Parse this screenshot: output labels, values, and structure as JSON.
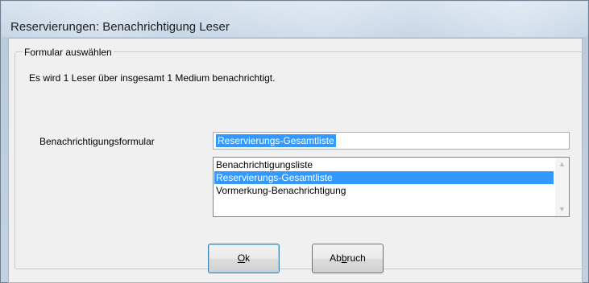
{
  "window": {
    "title": "Reservierungen: Benachrichtigung Leser"
  },
  "group": {
    "legend": "Formular auswählen",
    "info": "Es wird 1 Leser über  insgesamt 1 Medium benachrichtigt."
  },
  "form": {
    "label": "Benachrichtigungsformular",
    "combo_value": "Reservierungs-Gesamtliste",
    "list_items": [
      "Benachrichtigungsliste",
      "Reservierungs-Gesamtliste",
      "Vormerkung-Benachrichtigung"
    ],
    "selected_index": 1
  },
  "buttons": {
    "ok_mnemonic": "O",
    "ok_rest": "k",
    "cancel_pre": "Ab",
    "cancel_mnemonic": "b",
    "cancel_rest": "ruch"
  },
  "icons": {
    "scroll_up": "chevron-up-icon",
    "scroll_down": "chevron-down-icon"
  },
  "colors": {
    "selection": "#3399ff",
    "dialog_bg": "#f0f0f0"
  }
}
